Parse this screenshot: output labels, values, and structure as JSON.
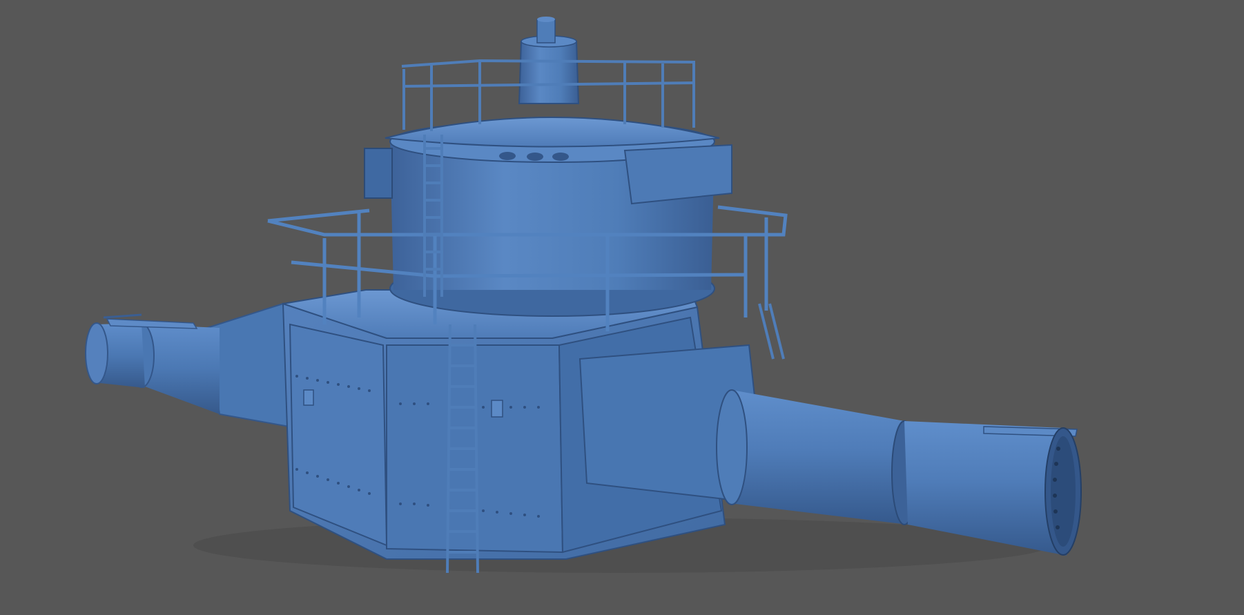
{
  "viewport": {
    "background_color": "#575757",
    "model_color": "#4c7ab7",
    "model_shadow_color": "#34578a",
    "model_highlight_color": "#6e9ad4"
  },
  "model": {
    "subject": "render",
    "parts": [
      "chimney",
      "upper-railing",
      "upper-drum",
      "lower-railing",
      "ladder",
      "octagonal-base",
      "left-pipe",
      "right-pipe",
      "end-flange"
    ]
  }
}
